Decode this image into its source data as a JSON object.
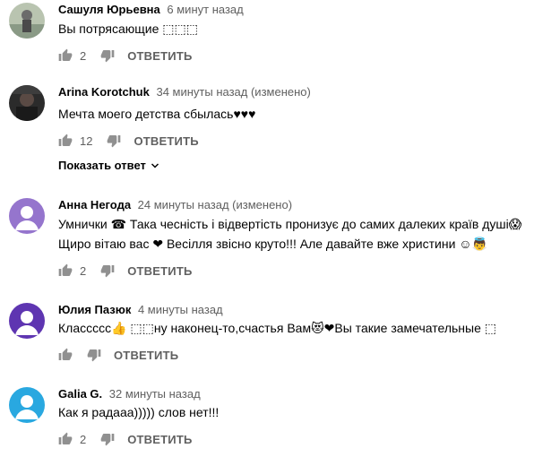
{
  "comments": [
    {
      "author": "Сашуля Юрьевна",
      "time": "6 минут назад",
      "text": "Вы потрясающие ",
      "emoji": "⬚⬚⬚",
      "likes": "2",
      "reply_label": "ОТВЕТИТЬ",
      "avatar": "photo-avatar"
    },
    {
      "author": "Arina Korotchuk",
      "time": "34 минуты назад (изменено)",
      "text": "Мечта моего детства сбылась♥♥♥",
      "likes": "12",
      "reply_label": "ОТВЕТИТЬ",
      "show_replies_label": "Показать ответ",
      "avatar": "photo-avatar"
    },
    {
      "author": "Анна Негода",
      "time": "24 минуты назад (изменено)",
      "text_line1": "Умнички ☎ Така чесність і відвертість пронизує до самих далеких країв душі😱",
      "text_line2": "Щиро вітаю вас ❤ Весілля звісно круто!!! Але давайте вже христини ☺👼",
      "likes": "2",
      "reply_label": "ОТВЕТИТЬ",
      "avatar_color": "#9575cd"
    },
    {
      "author": "Юлия Пазюк",
      "time": "4 минуты назад",
      "text": "Классссс👍 ⬚⬚ну наконец-то,счастья Вам😻❤Вы такие замечательные ⬚",
      "likes": "",
      "reply_label": "ОТВЕТИТЬ",
      "avatar_color": "#5e35b1"
    },
    {
      "author": "Galia G.",
      "time": "32 минуты назад",
      "text": "Как я радааа))))) слов нет!!!",
      "likes": "2",
      "reply_label": "ОТВЕТИТЬ",
      "avatar_color": "#29a8e0"
    }
  ],
  "icons": {
    "like": "thumb-up-icon",
    "dislike": "thumb-down-icon",
    "chevron": "chevron-down-icon"
  }
}
